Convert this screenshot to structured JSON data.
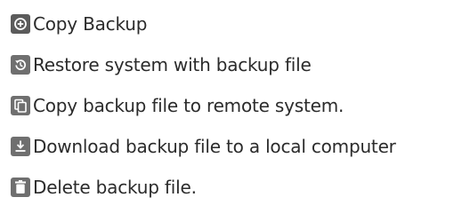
{
  "items": [
    {
      "icon": "copy-backup-icon",
      "label": "Copy Backup",
      "color": "#5b5b5b"
    },
    {
      "icon": "restore-icon",
      "label": "Restore system with backup file",
      "color": "#6f6f6f"
    },
    {
      "icon": "copy-remote-icon",
      "label": "Copy backup file to remote system.",
      "color": "#6f6f6f"
    },
    {
      "icon": "download-icon",
      "label": "Download backup file to a local computer",
      "color": "#6f6f6f"
    },
    {
      "icon": "delete-icon",
      "label": "Delete backup file.",
      "color": "#6f6f6f"
    }
  ]
}
